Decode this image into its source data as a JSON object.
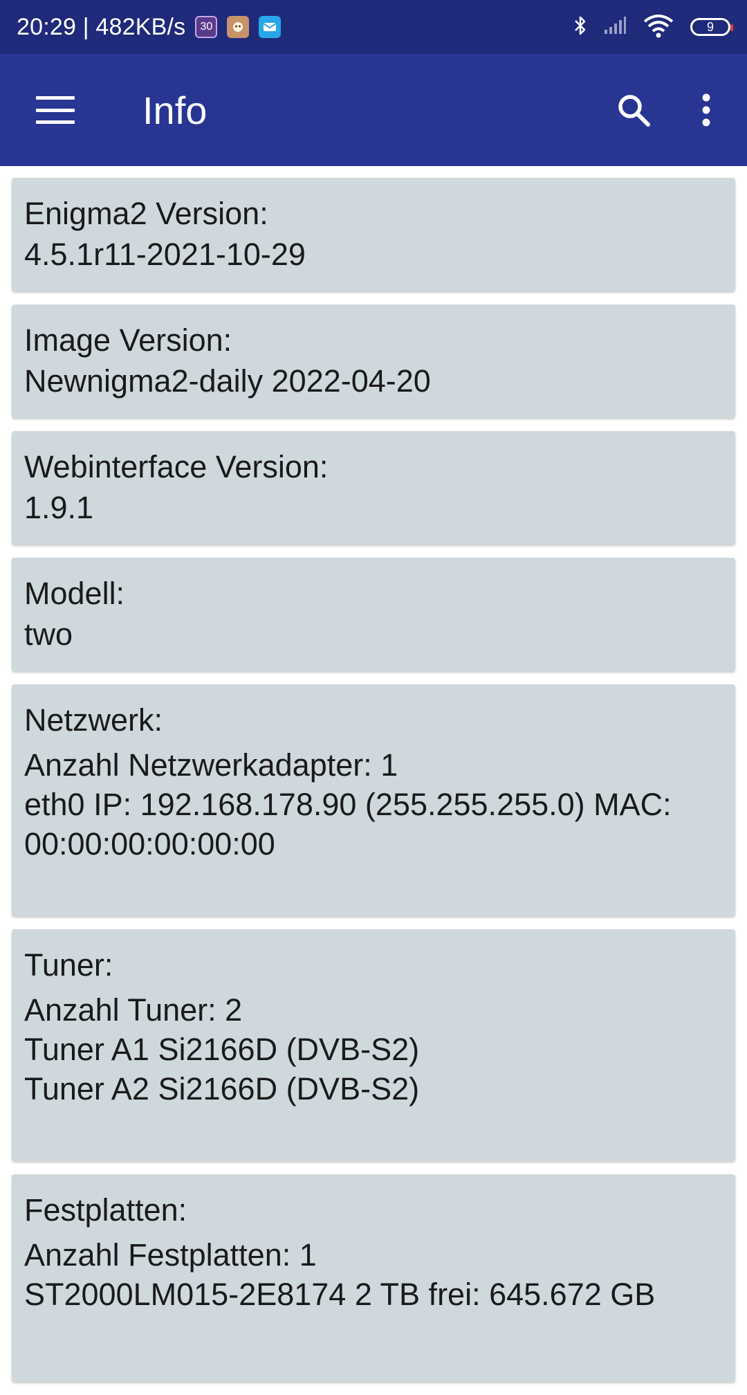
{
  "status_bar": {
    "time_speed": "20:29 | 482KB/s",
    "notif_1": "30",
    "battery": "9"
  },
  "app_bar": {
    "title": "Info"
  },
  "cards": [
    {
      "title": "Enigma2 Version:",
      "lines": [
        "4.5.1r11-2021-10-29"
      ]
    },
    {
      "title": "Image Version:",
      "lines": [
        "Newnigma2-daily 2022-04-20"
      ]
    },
    {
      "title": "Webinterface Version:",
      "lines": [
        "1.9.1"
      ]
    },
    {
      "title": "Modell:",
      "lines": [
        "two"
      ]
    },
    {
      "title": "Netzwerk:",
      "lines": [
        "Anzahl Netzwerkadapter: 1",
        "eth0 IP: 192.168.178.90 (255.255.255.0) MAC:",
        "00:00:00:00:00:00"
      ]
    },
    {
      "title": "Tuner:",
      "lines": [
        "Anzahl Tuner: 2",
        "Tuner A1  Si2166D (DVB-S2)",
        "Tuner A2  Si2166D (DVB-S2)"
      ]
    },
    {
      "title": "Festplatten:",
      "lines": [
        "Anzahl Festplatten: 1",
        "ST2000LM015-2E8174 2 TB frei: 645.672 GB"
      ]
    }
  ]
}
